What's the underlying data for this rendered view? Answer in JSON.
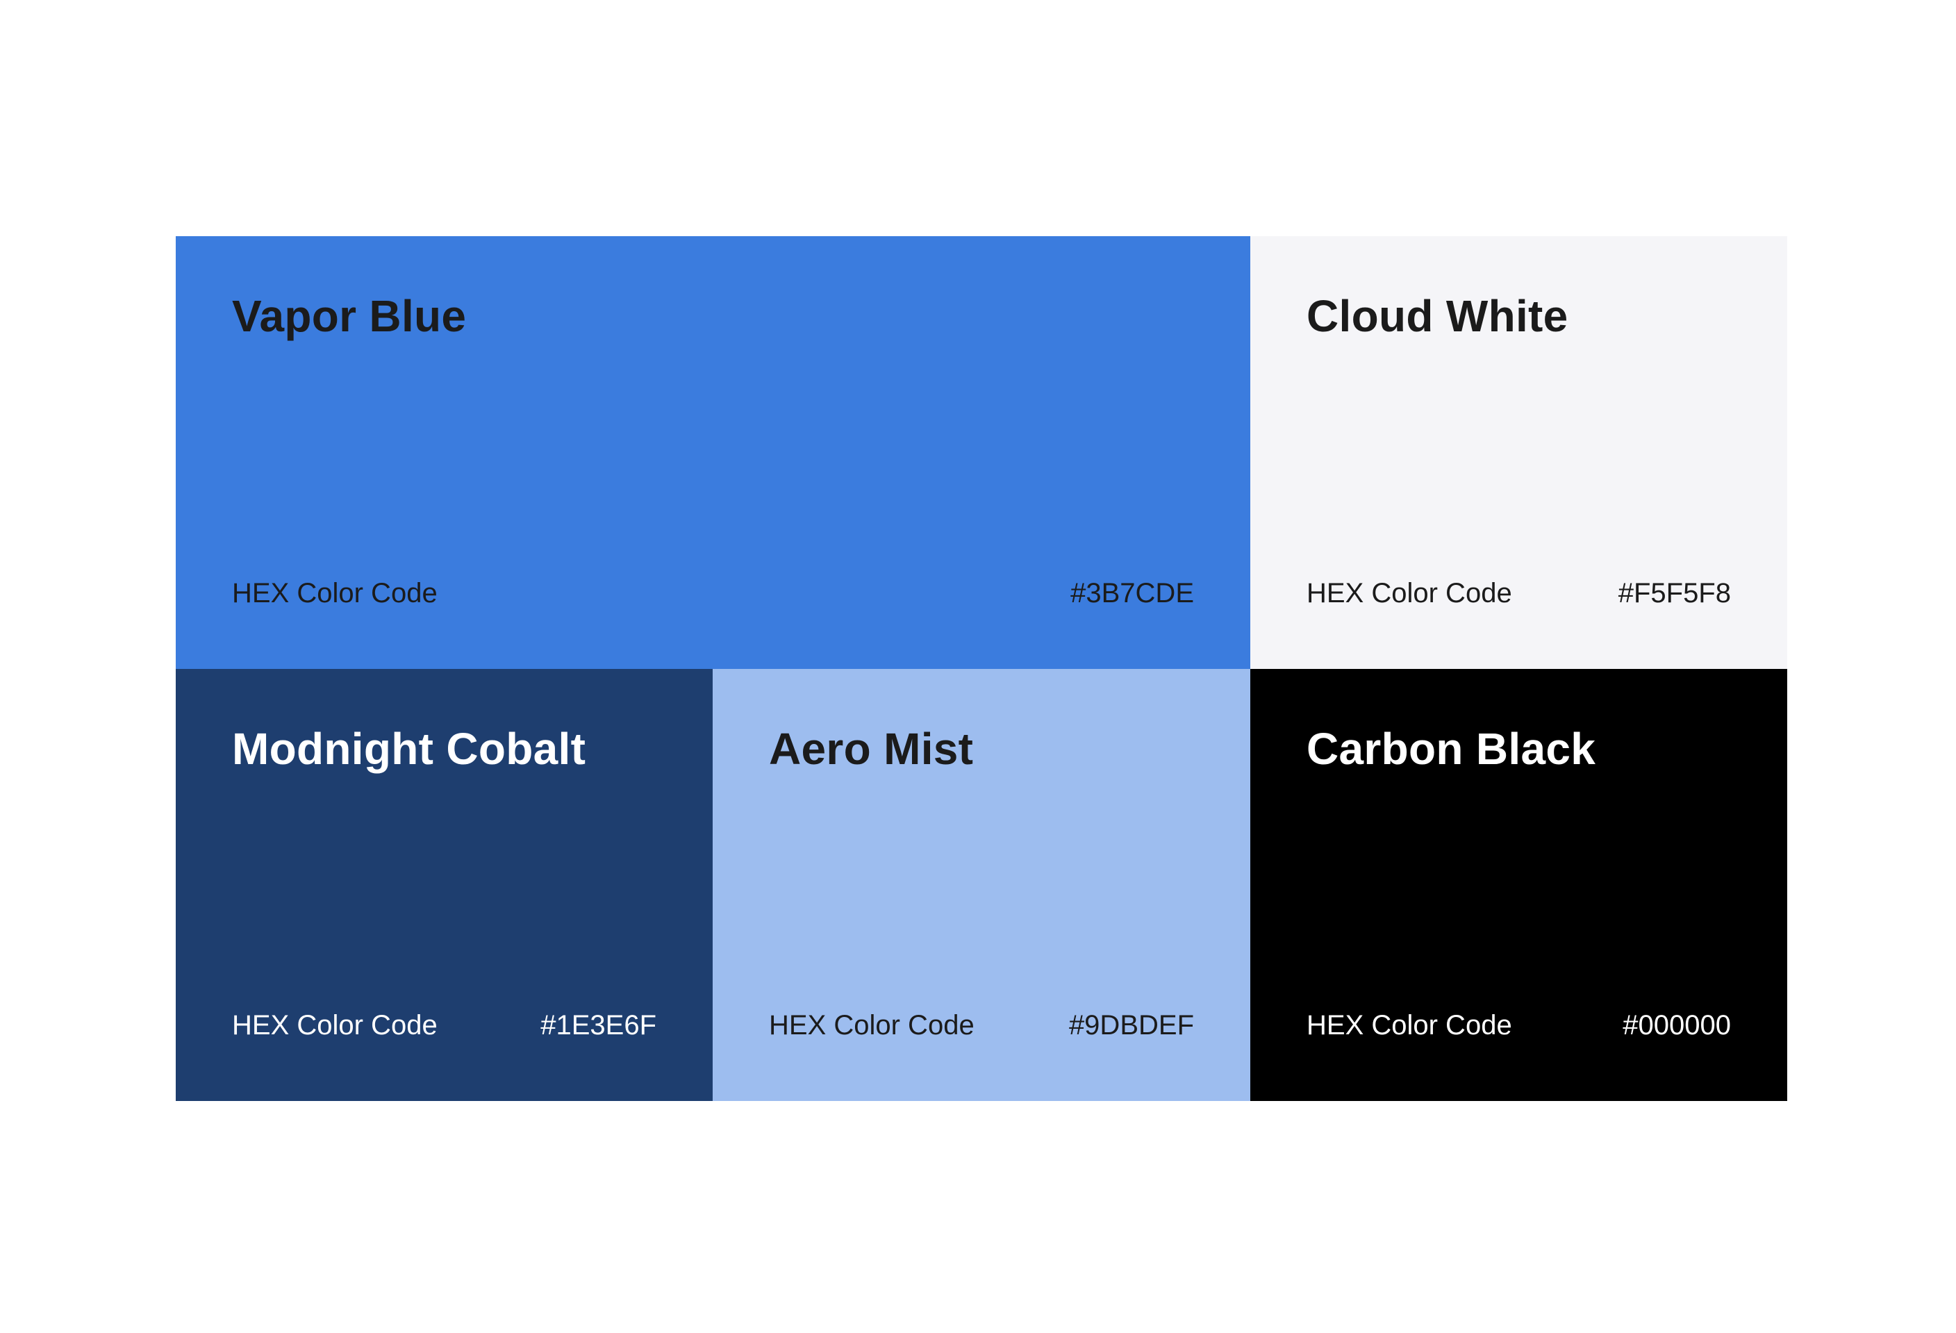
{
  "swatches": [
    {
      "name": "Vapor Blue",
      "code_label": "HEX Color Code",
      "hex": "#3B7CDE",
      "color": "#3B7CDE",
      "text_color": "#1b1b1b"
    },
    {
      "name": "Cloud White",
      "code_label": "HEX Color Code",
      "hex": "#F5F5F8",
      "color": "#F5F5F8",
      "text_color": "#1b1b1b"
    },
    {
      "name": "Modnight Cobalt",
      "code_label": "HEX Color Code",
      "hex": "#1E3E6F",
      "color": "#1E3E6F",
      "text_color": "#ffffff"
    },
    {
      "name": "Aero Mist",
      "code_label": "HEX Color Code",
      "hex": "#9DBDEF",
      "color": "#9DBDEF",
      "text_color": "#1b1b1b"
    },
    {
      "name": "Carbon Black",
      "code_label": "HEX Color Code",
      "hex": "#000000",
      "color": "#000000",
      "text_color": "#ffffff"
    }
  ]
}
